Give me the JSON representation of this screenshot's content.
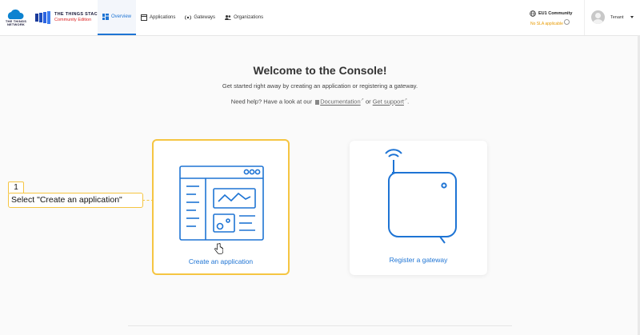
{
  "brand": {
    "ttn_text": "THE THINGS NETWORK",
    "stack_title": "THE THINGS STACK",
    "stack_sub": "Community Edition"
  },
  "nav": [
    {
      "label": "Overview",
      "icon": "dashboard-icon",
      "active": true
    },
    {
      "label": "Applications",
      "icon": "application-icon",
      "active": false
    },
    {
      "label": "Gateways",
      "icon": "gateway-icon",
      "active": false
    },
    {
      "label": "Organizations",
      "icon": "organizations-icon",
      "active": false
    }
  ],
  "header": {
    "region": "EU1 Community",
    "banner": "No SLA applicable",
    "user": "Tenant"
  },
  "main": {
    "title": "Welcome to the Console!",
    "subtitle": "Get started right away by creating an application or registering a gateway.",
    "help_prefix": "Need help? Have a look at our",
    "doc_link": "Documentation",
    "or_text": "or",
    "support_link": "Get support",
    "period": "."
  },
  "cards": {
    "app_label": "Create an application",
    "gateway_label": "Register a gateway"
  },
  "callout": {
    "number": "1",
    "text": "Select \"Create an application\""
  },
  "colors": {
    "accent": "#1e74d4",
    "highlight": "#f5c542",
    "warning": "#e89a00"
  }
}
